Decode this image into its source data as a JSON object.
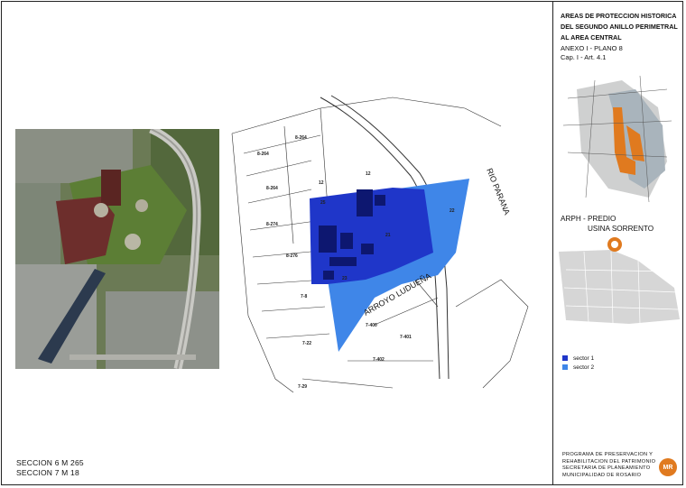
{
  "section_codes": [
    "SECCION 6  M 265",
    "SECCION 7  M 18"
  ],
  "sidebar": {
    "title_lines": [
      "AREAS DE PROTECCION HISTORICA",
      "DEL SEGUNDO ANILLO PERIMETRAL",
      "AL AREA CENTRAL"
    ],
    "annex_lines": [
      "ANEXO I - PLANO 8",
      "Cap. I - Art. 4.1"
    ],
    "arph_lines": [
      "ARPH - PREDIO",
      "USINA SORRENTO"
    ],
    "legend": [
      {
        "label": "sector 1",
        "color": "#1f36c9"
      },
      {
        "label": "sector 2",
        "color": "#3f86e8"
      }
    ],
    "program_lines": [
      "PROGRAMA DE PRESERVACION  Y",
      "REHABILITACION DEL PATRIMONIO",
      "SECRETARIA DE PLANEAMIENTO",
      "MUNICIPALIDAD DE ROSARIO"
    ],
    "logo_text": "MR"
  },
  "map": {
    "river_label": "RIO PARANA",
    "stream_label": "ARROYO LUDUEÑA",
    "block_labels": [
      "8-264",
      "8-264",
      "8-264",
      "8-274",
      "8-276",
      "7-8",
      "7-22",
      "7-400",
      "7-401",
      "7-402",
      "7-29",
      "12",
      "12",
      "22",
      "21",
      "23",
      "25"
    ]
  },
  "colors": {
    "sector1": "#1f36c9",
    "sector2": "#3f86e8",
    "accent": "#e07a1f",
    "building": "#0d1770"
  }
}
